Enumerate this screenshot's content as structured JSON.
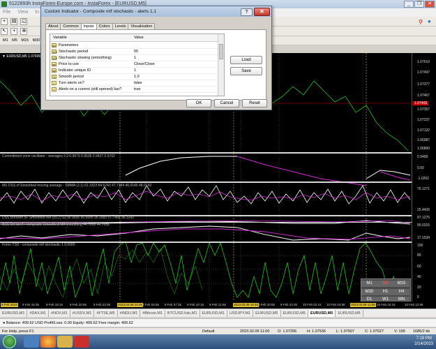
{
  "window": {
    "title": "5122893h  InstaForex-Europe.com - InstaForex - [EURUSD,M5]",
    "controls": [
      "_",
      "❐",
      "✕"
    ]
  },
  "menu": [
    "File",
    "View",
    "In"
  ],
  "toolbar3": [
    "M1",
    "M5",
    "M15",
    "M30"
  ],
  "chart": {
    "symbol_label": "▼ EURUSD,M5  1.07400 1.07",
    "price_labels": [
      "1.07610",
      "1.07497",
      "1.07377",
      "1.07467",
      "1.07357",
      "1.07237",
      "1.07122",
      "1.06987",
      "1.06860"
    ],
    "current_price": "1.07409",
    "ind1": {
      "title": "Commitment zone oscillator - averages 2.2  0.9679  0.9535  0.9427  0.9702",
      "scale": [
        "0.9499",
        "0.00",
        "-1.0262"
      ]
    },
    "ind2": {
      "title": "MS DSS of Smoothed moving average - SMMA (2.1)  61.3323  84.5243  47.7184  46.0145  48.0143",
      "scale": [
        "76.1271",
        "25.4426"
      ]
    },
    "ind3": {
      "title": "DSS Bressert oF Smoothed MA (55.2)  92.96  9695 96.9995 96.1685 57.7468 96.3260",
      "scale": [
        "97.1275",
        "90.0315"
      ]
    },
    "ind4": {
      "title": "DSS Bressert - composite Smoothed MA smoothing  44.7658  44.7658",
      "scale": [
        "17.1534"
      ]
    },
    "ind5": {
      "title": "Forex-TSD - composite mtf stochastic  1  0.0000",
      "scale": [
        "100",
        "80",
        "60",
        "40",
        "20",
        "0"
      ]
    },
    "timeframes": [
      [
        "M1",
        "M5",
        "M15"
      ],
      [
        "M30",
        "H1",
        "H4"
      ],
      [
        "D1",
        "W1",
        "MN"
      ]
    ],
    "active_timeframe": "M5"
  },
  "timescale": [
    "9 Feb 2023",
    "9 Feb 15:35",
    "9 Feb 18:15",
    "9 Feb 20:55",
    "9 Feb 23:35",
    "2023.02.09 10:45",
    "9 Feb 04:55",
    "9 Feb 07:35",
    "9 Feb 10:15",
    "9 Feb 12:55",
    "2023.02.09 10:45",
    "9 Feb 20:55",
    "9 Feb 23:35",
    "10 Feb 02:15",
    "10 Feb 04:55",
    "2023.02.09 11:00",
    "10 Feb 10:15",
    "10 Feb 12:55"
  ],
  "chart_tabs": [
    "EURUSD,M1",
    "#DAX,M1",
    "#NDX,M1",
    "#USDX,M1",
    "#FTSE,M5",
    "#INDU,M1",
    "#Bitcoin,M1",
    "BTCUSD.futu,M1",
    "EURUSD,M1",
    "USDJPY,M1",
    "EURUSD,M5",
    "EURUSD,M5",
    "EURUSD,M5",
    "EURUSD,M5"
  ],
  "active_tab_index": 12,
  "balance": "● Balance: 499.62 USD  Profit/Loss: 0.00  Equity: 499.62  Free margin: 499.62",
  "status": {
    "help": "For Help, press F1",
    "profile": "Default",
    "datetime": "2023.02.09 11:00",
    "open": "O: 1.07256",
    "high": "H: 1.07536",
    "low": "L: 1.07507",
    "close": "C: 1.07527",
    "volume": "V: 199",
    "traffic": "1685/2 kb"
  },
  "taskbar": {
    "time": "7:19 PM",
    "date": "2/14/2023"
  },
  "dialog": {
    "title": "Custom Indicator - Composite mtf stochastic - alerts 1.1",
    "help": "?",
    "close": "✕",
    "tabs": [
      "About",
      "Common",
      "Inputs",
      "Colors",
      "Levels",
      "Visualization"
    ],
    "active_tab": "Inputs",
    "columns": {
      "variable": "Variable",
      "value": "Value"
    },
    "rows": [
      {
        "name": "Parameters",
        "value": ""
      },
      {
        "name": "Stochastic period",
        "value": "55"
      },
      {
        "name": "Stochastic slowing (smoothing)",
        "value": "1"
      },
      {
        "name": "Price to use",
        "value": "Close/Close"
      },
      {
        "name": "Indicator unique ID",
        "value": "1"
      },
      {
        "name": "Smooth period",
        "value": "1.0"
      },
      {
        "name": "Turn alerts on?",
        "value": "false"
      },
      {
        "name": "Alerts on a current (still opened) bar?",
        "value": "true"
      }
    ],
    "load": "Load",
    "save": "Save",
    "ok": "OK",
    "cancel": "Cancel",
    "reset": "Reset"
  }
}
